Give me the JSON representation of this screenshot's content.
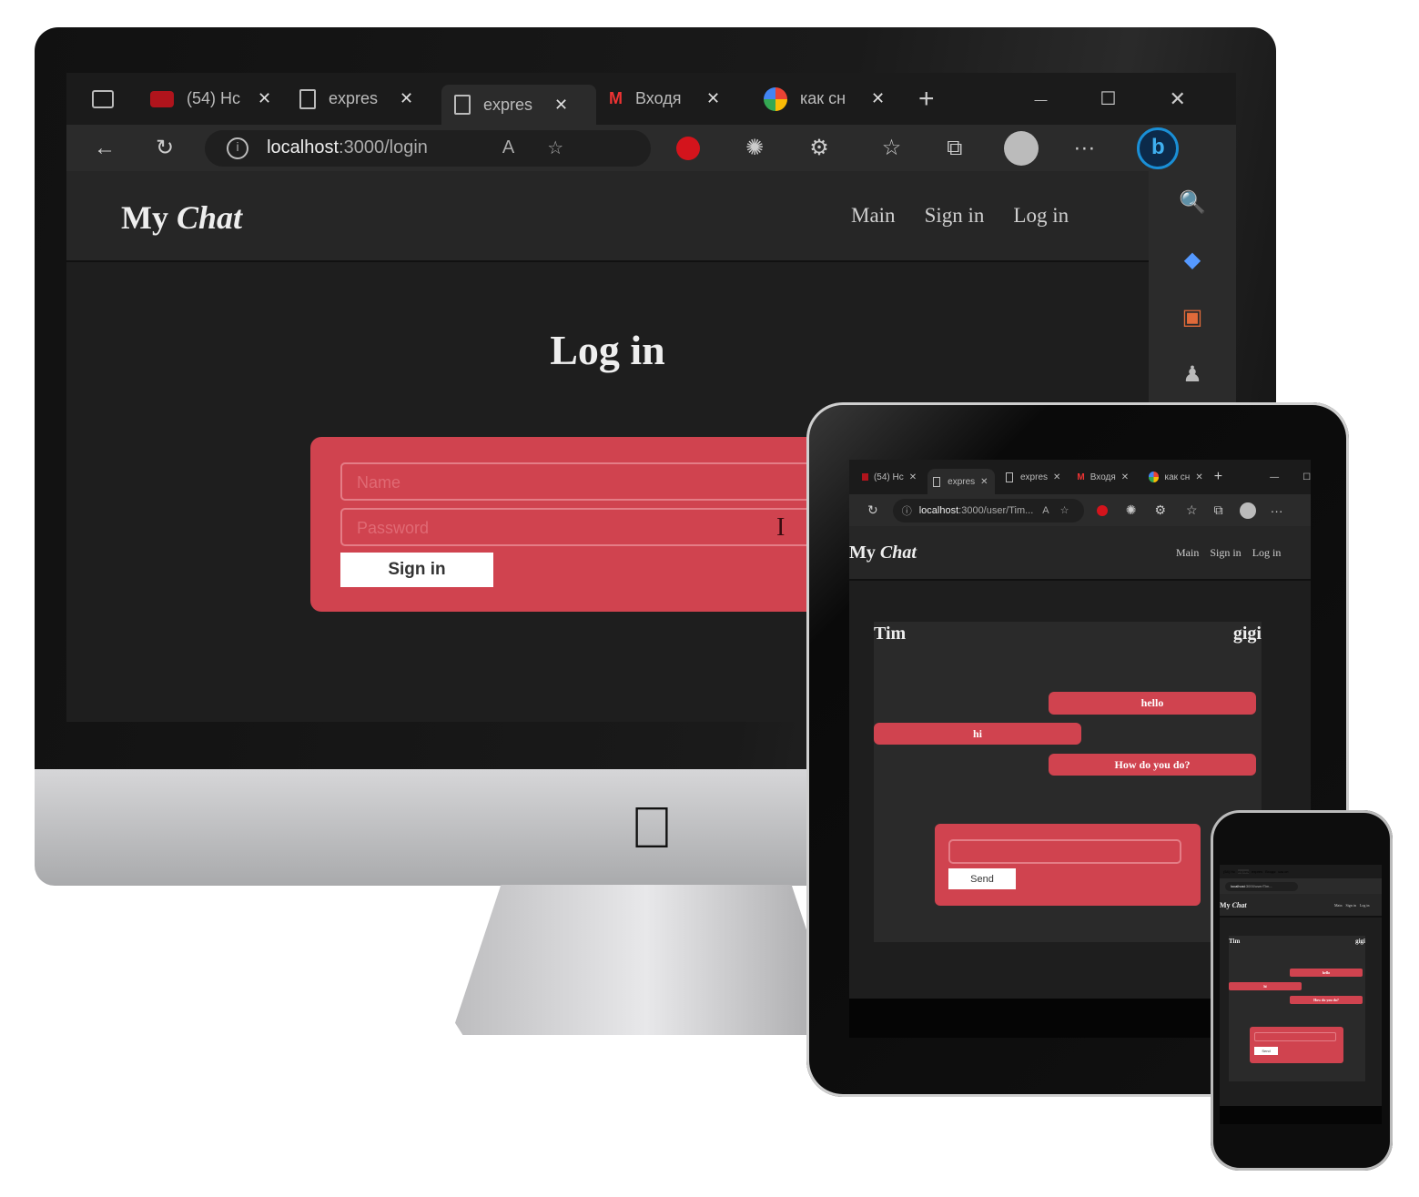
{
  "browser": {
    "tabs": [
      {
        "label": "(54) Hc",
        "icon": "youtube-icon"
      },
      {
        "label": "expres",
        "icon": "page-icon"
      },
      {
        "label": "expres",
        "icon": "page-icon"
      },
      {
        "label": "Входя",
        "icon": "gmail-icon"
      },
      {
        "label": "как сн",
        "icon": "google-icon"
      }
    ],
    "tabs_tablet": [
      {
        "label": "(54) Hc"
      },
      {
        "label": "expres"
      },
      {
        "label": "expres"
      },
      {
        "label": "Входя"
      },
      {
        "label": "как сн"
      }
    ],
    "close_glyph": "✕",
    "new_tab": "+",
    "minimize": "—",
    "maximize": "☐",
    "close_window": "✕",
    "url_desktop_host": "localhost",
    "url_desktop_path": ":3000/login",
    "url_tablet_host": "localhost",
    "url_tablet_path": ":3000/user/Tim...",
    "more": "···"
  },
  "site": {
    "brand_my": "My",
    "brand_chat": "Chat",
    "nav": [
      "Main",
      "Sign in",
      "Log in"
    ]
  },
  "login": {
    "title": "Log in",
    "name_placeholder": "Name",
    "password_placeholder": "Password",
    "submit": "Sign in"
  },
  "chat": {
    "left_user": "Tim",
    "right_user": "gigi",
    "messages": [
      {
        "text": "hello",
        "side": "right"
      },
      {
        "text": "hi",
        "side": "left"
      },
      {
        "text": "How do you do?",
        "side": "right"
      }
    ],
    "send": "Send"
  },
  "colors": {
    "accent": "#d0434f",
    "page_bg": "#1e1e1e",
    "header_bg": "#262626"
  }
}
